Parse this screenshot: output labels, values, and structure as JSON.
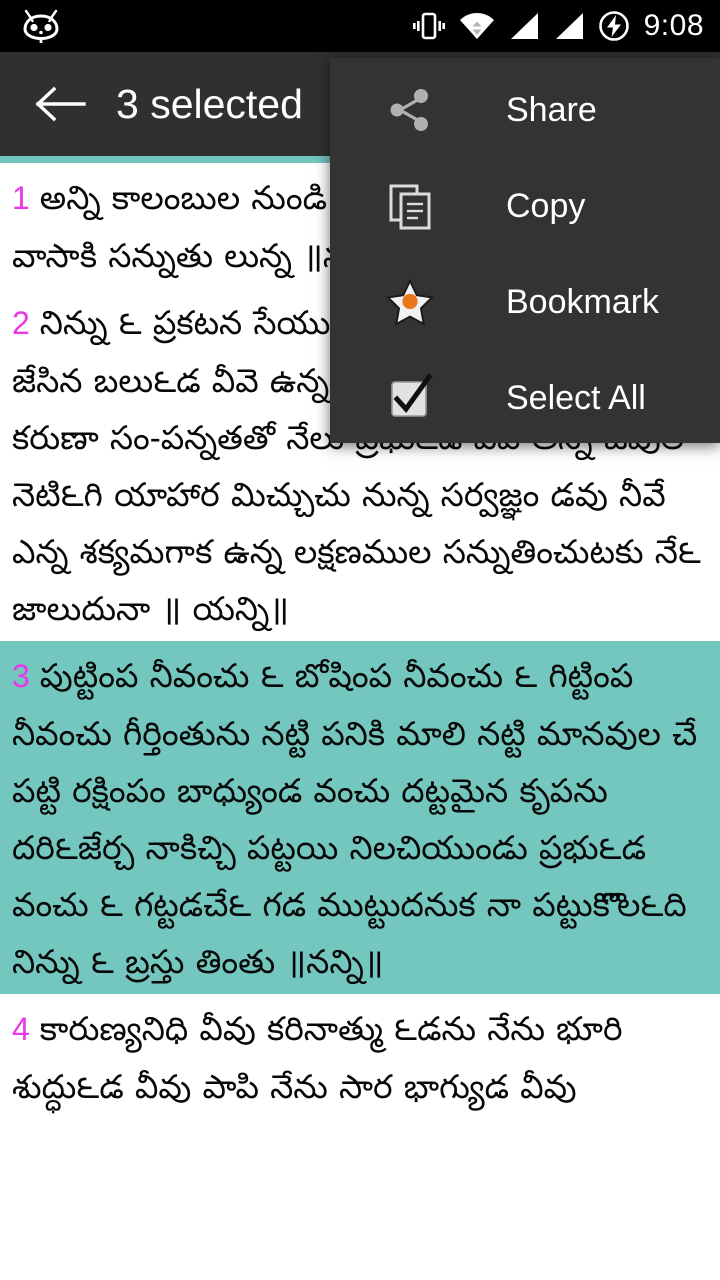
{
  "status_bar": {
    "logo_icon": "cyanogenmod-logo-icon",
    "icons": [
      {
        "name": "vibrate-icon"
      },
      {
        "name": "wifi-icon"
      },
      {
        "name": "signal-bars-sim1-icon"
      },
      {
        "name": "signal-bars-sim2-icon"
      },
      {
        "name": "battery-charging-icon"
      }
    ],
    "clock": "9:08"
  },
  "toolbar": {
    "back_icon": "back-arrow-icon",
    "title": "3 selected"
  },
  "menu": {
    "items": [
      {
        "label": "Share",
        "icon": "share-icon"
      },
      {
        "label": "Copy",
        "icon": "copy-icon"
      },
      {
        "label": "Bookmark",
        "icon": "bookmark-star-icon"
      },
      {
        "label": "Select All",
        "icon": "checkbox-checked-icon"
      }
    ]
  },
  "colors": {
    "accent_teal": "#74c5bd",
    "highlight_teal": "#74c7bf",
    "verse_number_magenta": "#e838e8",
    "toolbar_dark": "#303030",
    "menu_dark": "#333333",
    "bookmark_orange": "#e8761a"
  },
  "content": {
    "verses": [
      {
        "number": "1",
        "selected": false,
        "text": "అన్ని కాలంబుల నుండి నెన్న �(దరంబయొ కన్న వాసాకి సన్నుతు లున్న ॥నన్ని॥"
      },
      {
        "number": "2",
        "selected": false,
        "text": "నిన్ను ౬ ప్రకటన సేయు నఖిల జీవులను బన్నుగ౬ జేసిన బలు౬డ వీవె ఉన్న లోకంబుల – నుడుగక కరుణా సం-పన్నతతో నేలు ప్రభు౬డ వీవె అన్ని జీవుల నెటి౬గి యాహార మిచ్చుచు నున్న సర్వజ్ఞం డవు నీవే ఎన్న శక్యమగాక ఉన్న లక్షణముల సన్నుతించుటకు నే౬ జాలుదునా ॥ యన్ని॥"
      },
      {
        "number": "3",
        "selected": true,
        "text": "పుట్టింప నీవంచు ౬ బోషింప నీవంచు ౬ గిట్టింప నీవంచు గీర్తింతును నట్టి పనికి మాలి నట్టి మానవుల చే పట్టి రక్షింపం బాధ్యుండ వంచు దట్టమైన కృపను దరి౬జేర్చ నాకిచ్చి పట్టయి నిలచియుండు ప్రభు౬డ వంచు ౬ గట్టడచే౬ గడ ముట్టుదనుక నా పట్టుకొొల౬ది నిన్ను ౬ బ్రస్తు తింతు ॥నన్ని॥"
      },
      {
        "number": "4",
        "selected": false,
        "text": "కారుణ్యనిధి వీవు కరినాత్ము ౬డను నేను భూరి శుద్ధు౬డ వీవు పాపి నేను సార భాగ్యుడ వీవు"
      }
    ]
  }
}
